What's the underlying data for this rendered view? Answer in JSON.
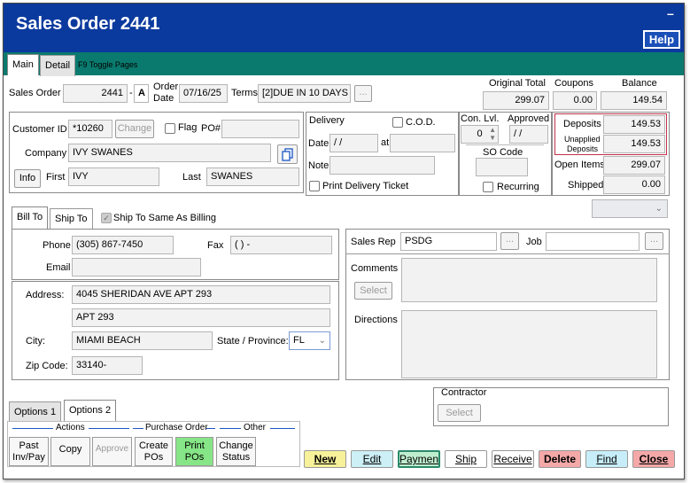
{
  "window": {
    "title": "Sales Order 2441",
    "minimize": "–",
    "help": "Help"
  },
  "tabs": {
    "main": "Main",
    "detail": "Detail",
    "hint": "F9 Toggle Pages"
  },
  "order": {
    "sales_order_label": "Sales Order",
    "sales_order": "2441",
    "suffix_sep": "-",
    "suffix": "A",
    "order_date_label1": "Order",
    "order_date_label2": "Date",
    "order_date": "07/16/25",
    "terms_label": "Terms",
    "terms": "[2]DUE IN 10 DAYS",
    "terms_lookup": "...",
    "original_total_label": "Original Total",
    "original_total": "299.07",
    "coupons_label": "Coupons",
    "coupons": "0.00",
    "balance_label": "Balance",
    "balance": "149.54"
  },
  "customer": {
    "id_label": "Customer ID",
    "id": "*10260",
    "change": "Change",
    "flag_label": "Flag",
    "po_label": "PO#",
    "po": "",
    "company_label": "Company",
    "company": "IVY SWANES",
    "info": "Info",
    "first_label": "First",
    "first": "IVY",
    "last_label": "Last",
    "last": "SWANES"
  },
  "delivery": {
    "header": "Delivery",
    "cod_label": "C.O.D.",
    "date_label": "Date",
    "date": " / /",
    "at_label": "at",
    "at": "",
    "note_label": "Note",
    "note": "",
    "print_ticket": "Print Delivery Ticket"
  },
  "approval": {
    "con_lvl_label": "Con. Lvl.",
    "con_lvl": "0",
    "approved_label": "Approved",
    "approved": " / /",
    "so_code_label": "SO Code",
    "so_code": "",
    "recurring": "Recurring"
  },
  "totals": {
    "deposits_label": "Deposits",
    "deposits": "149.53",
    "unapplied_label1": "Unapplied",
    "unapplied_label2": "Deposits",
    "unapplied": "149.53",
    "open_items_label": "Open Items",
    "open_items": "299.07",
    "shipped_label": "Shipped",
    "shipped": "0.00"
  },
  "address_tabs": {
    "bill_to": "Bill To",
    "ship_to": "Ship To",
    "same_as_billing": "Ship To Same As Billing"
  },
  "contact": {
    "phone_label": "Phone",
    "phone": "(305) 867-7450",
    "fax_label": "Fax",
    "fax": "(  )   -",
    "email_label": "Email",
    "email": ""
  },
  "address": {
    "address_label": "Address:",
    "line1": "4045 SHERIDAN AVE APT 293",
    "line2": "APT 293",
    "city_label": "City:",
    "city": "MIAMI BEACH",
    "state_label": "State / Province:",
    "state": "FL",
    "zip_label": "Zip Code:",
    "zip": "33140-"
  },
  "sales": {
    "rep_label": "Sales Rep",
    "rep": "PSDG",
    "rep_lookup": "...",
    "job_label": "Job",
    "job": "",
    "job_lookup": "...",
    "comments_label": "Comments",
    "comments_select": "Select",
    "directions_label": "Directions",
    "contractor_label": "Contractor",
    "contractor_select": "Select"
  },
  "options": {
    "tab1": "Options 1",
    "tab2": "Options 2",
    "group_actions": "Actions",
    "group_po": "Purchase Order",
    "group_other": "Other",
    "past_inv_1": "Past",
    "past_inv_2": "Inv/Pay",
    "copy": "Copy",
    "approve": "Approve",
    "create_pos_1": "Create",
    "create_pos_2": "POs",
    "print_pos_1": "Print",
    "print_pos_2": "POs",
    "change_status_1": "Change",
    "change_status_2": "Status"
  },
  "actions": {
    "new": "New",
    "edit": "Edit",
    "payment": "Paymen",
    "ship": "Ship",
    "receive": "Receive",
    "delete": "Delete",
    "find": "Find",
    "close": "Close"
  },
  "colors": {
    "title_bar": "#0b3a9e",
    "tab_bar": "#0a7a6e",
    "new": "#f7f19a",
    "edit": "#cdeff6",
    "payment": "#bfeecf",
    "delete": "#f4a8a8",
    "find": "#c7eef8",
    "close": "#f4a8a8",
    "print_pos": "#86e586"
  }
}
